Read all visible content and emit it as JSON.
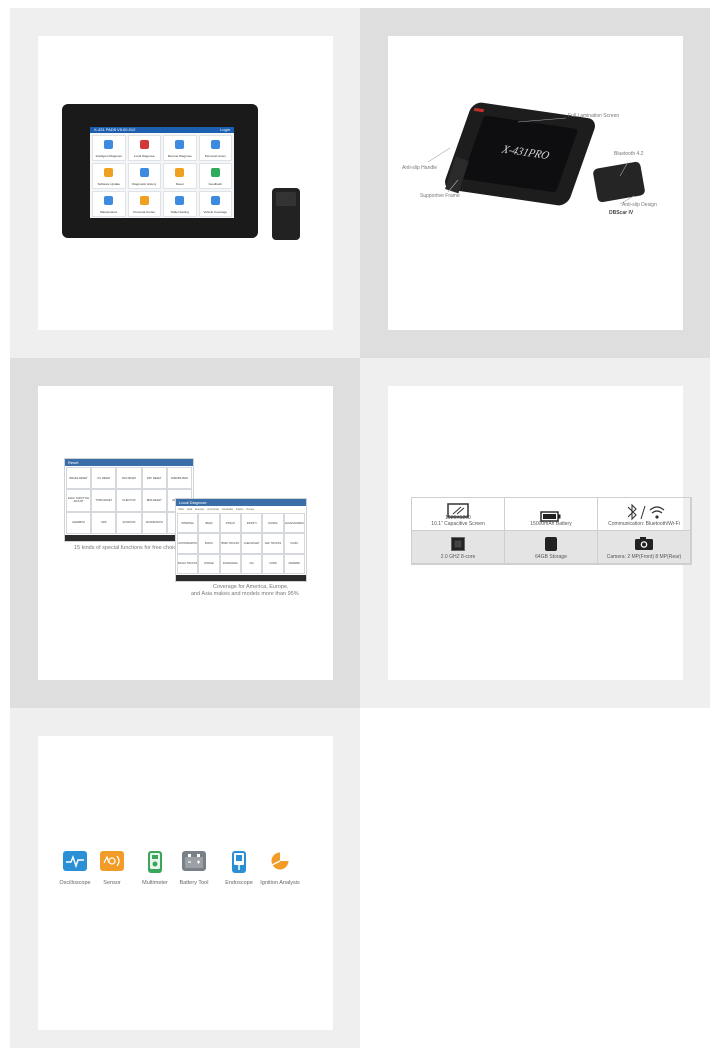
{
  "tile1": {
    "screen_title": "X-431 PAD5 V5.00.012",
    "screen_right": "Login",
    "apps": [
      {
        "label": "Intelligent Diagnose",
        "color": "#3d8be0",
        "icon": "cloud-icon"
      },
      {
        "label": "Local Diagnose",
        "color": "#d23a3a",
        "icon": "car-icon"
      },
      {
        "label": "Remote Diagnose",
        "color": "#3d8be0",
        "icon": "monitor-icon"
      },
      {
        "label": "Personal center",
        "color": "#3d8be0",
        "icon": "gift-icon"
      },
      {
        "label": "Software Update",
        "color": "#f0a020",
        "icon": "upload-icon"
      },
      {
        "label": "Diagnostic History",
        "color": "#3d8be0",
        "icon": "history-icon"
      },
      {
        "label": "Reset",
        "color": "#f0a020",
        "icon": "reset-icon"
      },
      {
        "label": "Feedback",
        "color": "#2eaa5c",
        "icon": "feedback-icon"
      },
      {
        "label": "Maintenance",
        "color": "#3d8be0",
        "icon": "maintenance-icon"
      },
      {
        "label": "Personal Center",
        "color": "#f0a020",
        "icon": "user-icon"
      },
      {
        "label": "Tablet Setting",
        "color": "#3d8be0",
        "icon": "tablet-icon"
      },
      {
        "label": "Vehicle Coverage",
        "color": "#3d8be0",
        "icon": "coverage-icon"
      },
      {
        "label": "Toolbox",
        "color": "#888888",
        "icon": "toolbox-icon"
      },
      {
        "label": "Other Modules",
        "color": "#3d8be0",
        "icon": "modules-icon"
      }
    ]
  },
  "tile2": {
    "brand": "X-431PRO",
    "callouts": {
      "lamination": "Full Lamination Screen",
      "handle": "Anti-slip Handle",
      "frame": "Supportive Frame",
      "bluetooth": "Bluetooth 4.2",
      "design": "Anti-slip Design",
      "dongle": "DBScar IV"
    }
  },
  "tile3": {
    "reset_title": "Reset",
    "reset_items": [
      "BRAKE RESET",
      "OIL RESET",
      "SAS RESET",
      "DPF RESET",
      "IMMOBILIZER",
      "ELEC THROTTLE ADJUST",
      "TPMS RESET",
      "INJECTOR",
      "BMS RESET",
      "HEADLAMP",
      "GEARBOX",
      "SRS",
      "SUNROOF",
      "SUSPENSION",
      "A/F"
    ],
    "caption_left": "15 kinds of special functions for free choice",
    "local_title": "Local Diagnose",
    "local_tabs": [
      "USA",
      "Asia",
      "Europe",
      "Americas",
      "Australia",
      "Japan",
      "Korea"
    ],
    "local_items": [
      "INTERNAL",
      "BENZ",
      "DTRAO",
      "INFINITI",
      "HONDA",
      "ACCESSORIES",
      "ASTONMARTIN",
      "BUICK",
      "BMW TRUCKS",
      "CHEVROLET",
      "DAF TRUCKS",
      "ISUZU",
      "BAJAJ TRUCKS",
      "DODGE",
      "DONGFENG",
      "KIA",
      "FORD",
      "FERRARI"
    ],
    "caption_right_1": "Coverage for America, Europe,",
    "caption_right_2": "and Asia makes and models more than 95%"
  },
  "tile4": {
    "specs": [
      {
        "text1": "1920X1200",
        "text2": "10.1\" Capacitive Screen",
        "icon": "screen-icon"
      },
      {
        "text1": "",
        "text2": "15000mAh Battery",
        "icon": "battery-icon"
      },
      {
        "text1": "",
        "text2": "Communication: Bluetooth/Wi-Fi",
        "icon": "wireless-icon"
      },
      {
        "text1": "",
        "text2": "2.0 GHZ 8-core",
        "icon": "cpu-icon"
      },
      {
        "text1": "",
        "text2": "64GB Storage",
        "icon": "storage-icon"
      },
      {
        "text1": "",
        "text2": "Camera: 2 MP(Front)  8 MP(Rear)",
        "icon": "camera-icon"
      }
    ]
  },
  "tile5": {
    "tools": [
      {
        "label": "Oscilloscope",
        "color": "#2b8fd6",
        "icon": "oscilloscope-icon"
      },
      {
        "label": "Sensor",
        "color": "#f29b27",
        "icon": "sensor-icon"
      },
      {
        "label": "Multimeter",
        "color": "#3aa65c",
        "icon": "multimeter-icon"
      },
      {
        "label": "Battery Tool",
        "color": "#7a8088",
        "icon": "battery-tool-icon"
      },
      {
        "label": "Endoscope",
        "color": "#2b8fd6",
        "icon": "endoscope-icon"
      },
      {
        "label": "Ignition Analysis",
        "color": "#f29b27",
        "icon": "ignition-icon"
      }
    ]
  }
}
